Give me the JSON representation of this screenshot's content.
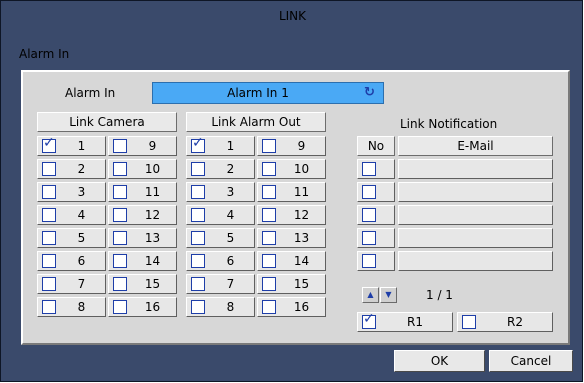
{
  "dialog": {
    "title": "LINK",
    "subtitle": "Alarm In"
  },
  "alarm_in": {
    "label": "Alarm In",
    "value": "Alarm In 1",
    "refresh_icon": "refresh-icon"
  },
  "link_camera": {
    "header": "Link Camera",
    "items": [
      {
        "label": "1",
        "checked": true
      },
      {
        "label": "2",
        "checked": false
      },
      {
        "label": "3",
        "checked": false
      },
      {
        "label": "4",
        "checked": false
      },
      {
        "label": "5",
        "checked": false
      },
      {
        "label": "6",
        "checked": false
      },
      {
        "label": "7",
        "checked": false
      },
      {
        "label": "8",
        "checked": false
      },
      {
        "label": "9",
        "checked": false
      },
      {
        "label": "10",
        "checked": false
      },
      {
        "label": "11",
        "checked": false
      },
      {
        "label": "12",
        "checked": false
      },
      {
        "label": "13",
        "checked": false
      },
      {
        "label": "14",
        "checked": false
      },
      {
        "label": "15",
        "checked": false
      },
      {
        "label": "16",
        "checked": false
      }
    ]
  },
  "link_alarm_out": {
    "header": "Link Alarm Out",
    "items": [
      {
        "label": "1",
        "checked": true
      },
      {
        "label": "2",
        "checked": false
      },
      {
        "label": "3",
        "checked": false
      },
      {
        "label": "4",
        "checked": false
      },
      {
        "label": "5",
        "checked": false
      },
      {
        "label": "6",
        "checked": false
      },
      {
        "label": "7",
        "checked": false
      },
      {
        "label": "8",
        "checked": false
      },
      {
        "label": "9",
        "checked": false
      },
      {
        "label": "10",
        "checked": false
      },
      {
        "label": "11",
        "checked": false
      },
      {
        "label": "12",
        "checked": false
      },
      {
        "label": "13",
        "checked": false
      },
      {
        "label": "14",
        "checked": false
      },
      {
        "label": "15",
        "checked": false
      },
      {
        "label": "16",
        "checked": false
      }
    ]
  },
  "link_notification": {
    "header": "Link Notification",
    "col_no": "No",
    "col_email": "E-Mail",
    "rows": [
      {
        "checked": false,
        "email": ""
      },
      {
        "checked": false,
        "email": ""
      },
      {
        "checked": false,
        "email": ""
      },
      {
        "checked": false,
        "email": ""
      },
      {
        "checked": false,
        "email": ""
      }
    ],
    "page": "1 / 1",
    "receivers": [
      {
        "label": "R1",
        "checked": true
      },
      {
        "label": "R2",
        "checked": false
      }
    ]
  },
  "buttons": {
    "ok": "OK",
    "cancel": "Cancel"
  },
  "colors": {
    "window_bg": "#3a4a6b",
    "panel_bg": "#d7d7d7",
    "selector_bg": "#4aa9f5",
    "checkbox_border": "#1e3ea8"
  }
}
